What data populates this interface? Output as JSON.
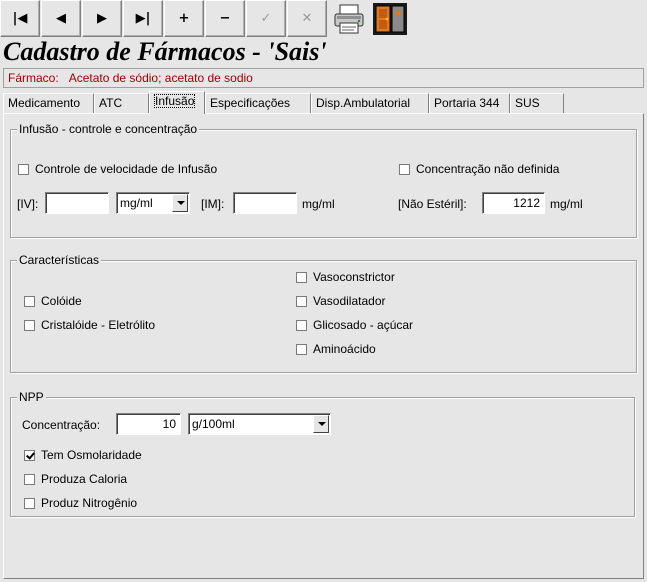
{
  "toolbar": {
    "first": "|◀",
    "prev": "◀",
    "next": "▶",
    "last": "▶|",
    "add": "+",
    "remove": "−",
    "confirm": "✓",
    "cancel": "✕",
    "print_icon": "printer-icon",
    "exit_icon": "exit-door-icon"
  },
  "title": "Cadastro de Fármacos - 'Sais'",
  "farmaco": {
    "label": "Fármaco:",
    "value": "Acetato de sódio; acetato de sodio"
  },
  "tabs": [
    {
      "label": "Medicamento"
    },
    {
      "label": "ATC"
    },
    {
      "label": "Infusão",
      "active": true
    },
    {
      "label": "Especificações"
    },
    {
      "label": "Disp.Ambulatorial"
    },
    {
      "label": "Portaria 344"
    },
    {
      "label": "SUS"
    }
  ],
  "infusao": {
    "legend": "Infusão  - controle e concentração",
    "controle_velocidade": {
      "label": "Controle de velocidade de Infusão",
      "checked": false
    },
    "concentracao_nao_definida": {
      "label": "Concentração não definida",
      "checked": false
    },
    "iv_label": "[IV]:",
    "iv_value": "",
    "iv_unit": "mg/ml",
    "im_label": "[IM]:",
    "im_value": "",
    "im_unit": "mg/ml",
    "nao_esteril_label": "[Não Estéril]:",
    "nao_esteril_value": "1212",
    "nao_esteril_unit": "mg/ml"
  },
  "caracteristicas": {
    "legend": "Características",
    "coloide": {
      "label": "Colóide",
      "checked": false
    },
    "cristaloide": {
      "label": "Cristalóide - Eletrólito",
      "checked": false
    },
    "vasoconstrictor": {
      "label": "Vasoconstrictor",
      "checked": false
    },
    "vasodilatador": {
      "label": "Vasodilatador",
      "checked": false
    },
    "glicosado": {
      "label": "Glicosado - açúcar",
      "checked": false
    },
    "aminoacido": {
      "label": "Aminoácido",
      "checked": false
    }
  },
  "npp": {
    "legend": "NPP",
    "concentracao_label": "Concentração:",
    "concentracao_value": "10",
    "concentracao_unit": "g/100ml",
    "tem_osmolaridade": {
      "label": "Tem Osmolaridade",
      "checked": true
    },
    "produza_caloria": {
      "label": "Produza Caloria",
      "checked": false
    },
    "produz_nitrogenio": {
      "label": "Produz Nitrogênio",
      "checked": false
    }
  }
}
